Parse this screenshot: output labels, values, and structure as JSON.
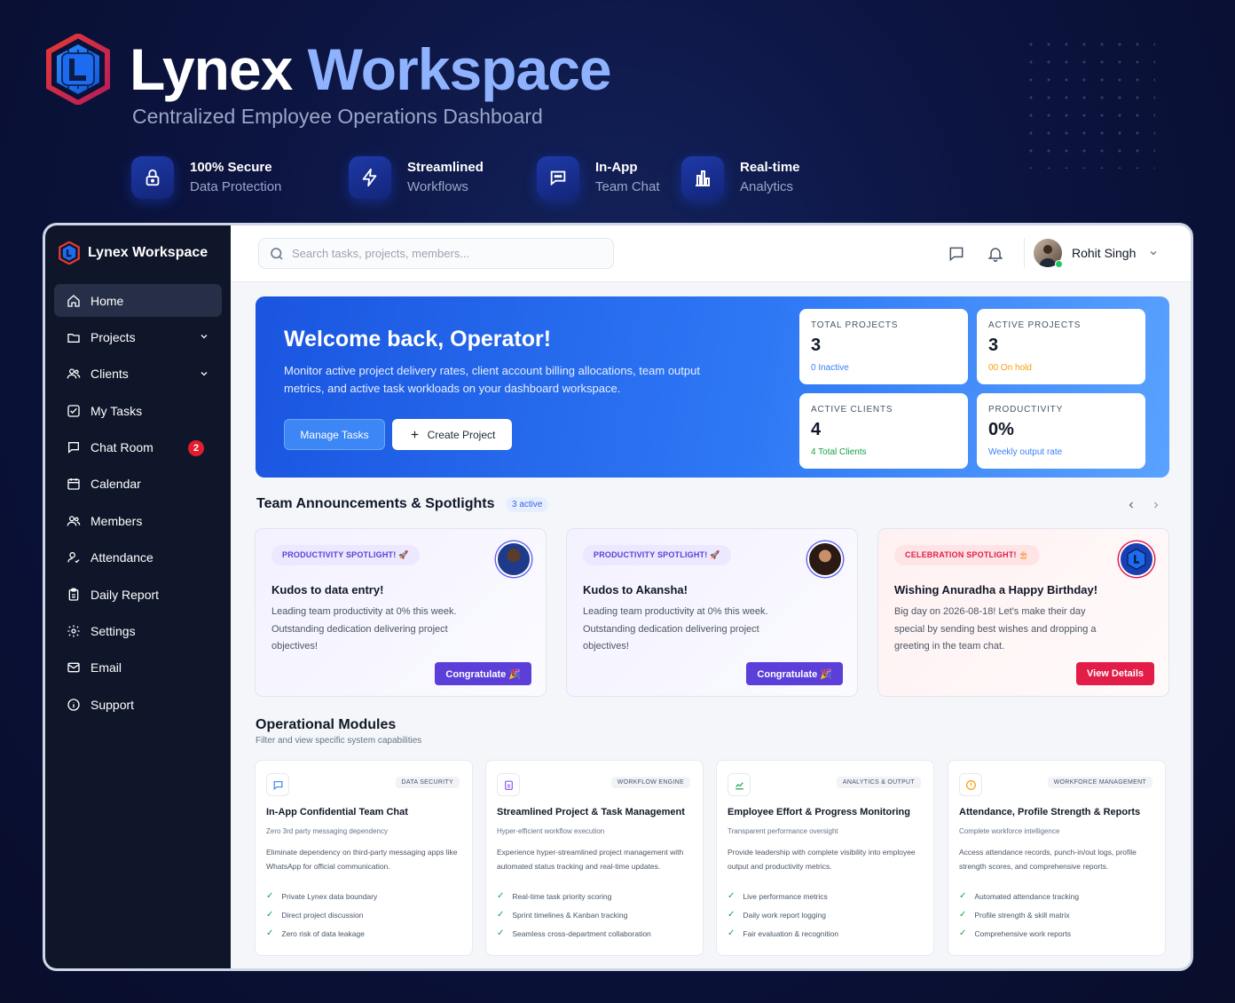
{
  "hero": {
    "title_part1": "Lynex",
    "title_part2": "Workspace",
    "subtitle": "Centralized Employee Operations Dashboard"
  },
  "features": [
    {
      "icon": "lock-icon",
      "title": "100% Secure",
      "subtitle": "Data Protection"
    },
    {
      "icon": "lightning-icon",
      "title": "Streamlined",
      "subtitle": "Workflows"
    },
    {
      "icon": "chat-icon",
      "title": "In-App",
      "subtitle": "Team Chat"
    },
    {
      "icon": "bar-chart-icon",
      "title": "Real-time",
      "subtitle": "Analytics"
    }
  ],
  "sidebar": {
    "brand": "Lynex Workspace",
    "items": [
      {
        "label": "Home",
        "icon": "home-icon",
        "active": true
      },
      {
        "label": "Projects",
        "icon": "folder-icon",
        "expandable": true
      },
      {
        "label": "Clients",
        "icon": "users-icon",
        "expandable": true
      },
      {
        "label": "My Tasks",
        "icon": "checkbox-icon"
      },
      {
        "label": "Chat Room",
        "icon": "chat-icon",
        "badge": "2"
      },
      {
        "label": "Calendar",
        "icon": "calendar-icon"
      },
      {
        "label": "Members",
        "icon": "members-icon"
      },
      {
        "label": "Attendance",
        "icon": "user-check-icon"
      },
      {
        "label": "Daily Report",
        "icon": "clipboard-icon"
      },
      {
        "label": "Settings",
        "icon": "gear-icon"
      },
      {
        "label": "Email",
        "icon": "mail-icon"
      },
      {
        "label": "Support",
        "icon": "info-icon"
      }
    ]
  },
  "topbar": {
    "search_placeholder": "Search tasks, projects, members...",
    "user_name": "Rohit Singh"
  },
  "welcome": {
    "title": "Welcome back, Operator!",
    "description": "Monitor active project delivery rates, client account billing allocations, team output metrics, and active task workloads on your dashboard workspace.",
    "manage_label": "Manage Tasks",
    "create_label": "Create Project"
  },
  "stats": [
    {
      "label": "TOTAL PROJECTS",
      "value": "3",
      "sub": "0 Inactive",
      "sub_color": "#3b82f6"
    },
    {
      "label": "ACTIVE PROJECTS",
      "value": "3",
      "sub": "00 On hold",
      "sub_color": "#f59e0b"
    },
    {
      "label": "ACTIVE CLIENTS",
      "value": "4",
      "sub": "4 Total Clients",
      "sub_color": "#16a34a"
    },
    {
      "label": "PRODUCTIVITY",
      "value": "0%",
      "sub": "Weekly output rate",
      "sub_color": "#3b82f6"
    }
  ],
  "announcements": {
    "title": "Team Announcements & Spotlights",
    "badge": "3 active",
    "cards": [
      {
        "tag": "PRODUCTIVITY SPOTLIGHT! 🚀",
        "title": "Kudos to data entry!",
        "desc": "Leading team productivity at 0% this week. Outstanding dedication delivering project objectives!",
        "button": "Congratulate 🎉",
        "theme": "purple"
      },
      {
        "tag": "PRODUCTIVITY SPOTLIGHT! 🚀",
        "title": "Kudos to Akansha!",
        "desc": "Leading team productivity at 0% this week. Outstanding dedication delivering project objectives!",
        "button": "Congratulate 🎉",
        "theme": "purple"
      },
      {
        "tag": "CELEBRATION SPOTLIGHT! 🎂",
        "title": "Wishing Anuradha a Happy Birthday!",
        "desc": "Big day on 2026-08-18! Let's make their day special by sending best wishes and dropping a greeting in the team chat.",
        "button": "View Details",
        "theme": "red"
      }
    ]
  },
  "modules": {
    "title": "Operational Modules",
    "subtitle": "Filter and view specific system capabilities",
    "items": [
      {
        "icon": "chat-icon",
        "tag": "DATA SECURITY",
        "title": "In-App Confidential Team Chat",
        "sub": "Zero 3rd party messaging dependency",
        "desc": "Eliminate dependency on third-party messaging apps like WhatsApp for official communication.",
        "points": [
          "Private Lynex data boundary",
          "Direct project discussion",
          "Zero risk of data leakage"
        ],
        "color": "#3b82f6"
      },
      {
        "icon": "clipboard-icon",
        "tag": "WORKFLOW ENGINE",
        "title": "Streamlined Project & Task Management",
        "sub": "Hyper-efficient workflow execution",
        "desc": "Experience hyper-streamlined project management with automated status tracking and real-time updates.",
        "points": [
          "Real-time task priority scoring",
          "Sprint timelines & Kanban tracking",
          "Seamless cross-department collaboration"
        ],
        "color": "#8b5cf6"
      },
      {
        "icon": "chart-icon",
        "tag": "ANALYTICS & OUTPUT",
        "title": "Employee Effort & Progress Monitoring",
        "sub": "Transparent performance oversight",
        "desc": "Provide leadership with complete visibility into employee output and productivity metrics.",
        "points": [
          "Live performance metrics",
          "Daily work report logging",
          "Fair evaluation & recognition"
        ],
        "color": "#16a34a"
      },
      {
        "icon": "alert-icon",
        "tag": "WORKFORCE MANAGEMENT",
        "title": "Attendance, Profile Strength & Reports",
        "sub": "Complete workforce intelligence",
        "desc": "Access attendance records, punch-in/out logs, profile strength scores, and comprehensive reports.",
        "points": [
          "Automated attendance tracking",
          "Profile strength & skill matrix",
          "Comprehensive work reports"
        ],
        "color": "#f59e0b"
      }
    ]
  }
}
